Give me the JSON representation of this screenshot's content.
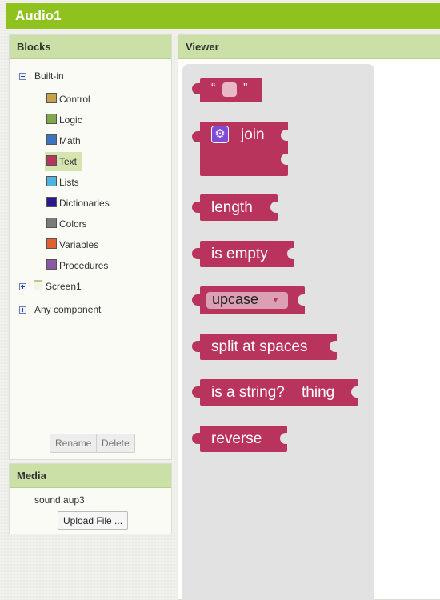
{
  "app": {
    "title": "Audio1"
  },
  "blocks_panel": {
    "header": "Blocks",
    "built_in_label": "Built-in",
    "categories": [
      {
        "label": "Control",
        "color": "#c8a24a"
      },
      {
        "label": "Logic",
        "color": "#7ea84a"
      },
      {
        "label": "Math",
        "color": "#3e73c0"
      },
      {
        "label": "Text",
        "color": "#b8345d"
      },
      {
        "label": "Lists",
        "color": "#4fb3e0"
      },
      {
        "label": "Dictionaries",
        "color": "#2a1890"
      },
      {
        "label": "Colors",
        "color": "#7b7b7b"
      },
      {
        "label": "Variables",
        "color": "#e06030"
      },
      {
        "label": "Procedures",
        "color": "#8b58a8"
      }
    ],
    "selected": "Text",
    "screen_label": "Screen1",
    "any_component_label": "Any component",
    "rename_label": "Rename",
    "delete_label": "Delete"
  },
  "media_panel": {
    "header": "Media",
    "file": "sound.aup3",
    "upload_label": "Upload File ..."
  },
  "viewer": {
    "header": "Viewer",
    "quote_left": "“",
    "quote_right": "”",
    "join_label": "join",
    "length_label": "length",
    "is_empty_label": "is empty",
    "upcase_label": "upcase",
    "split_label": "split at spaces",
    "is_string_label": "is a string?",
    "thing_label": "thing",
    "reverse_label": "reverse",
    "block_color": "#b8345d"
  }
}
